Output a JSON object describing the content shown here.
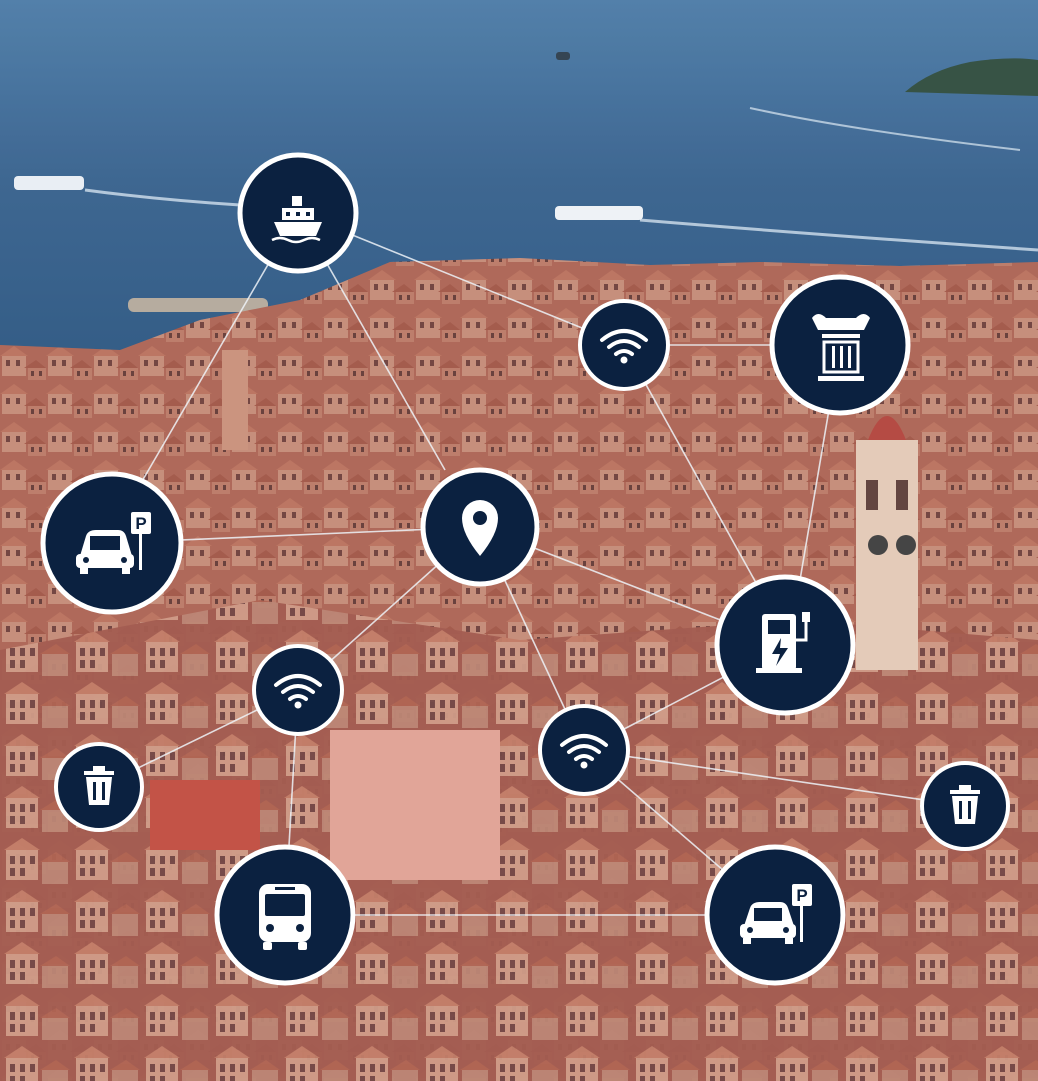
{
  "scene": {
    "description_colors": {
      "sea": "#3f6f9c",
      "sea_dark": "#2c5b88",
      "roof": "#c4694f",
      "wall": "#d9a08a",
      "icon_fill": "#0b2140",
      "icon_ring": "#ffffff",
      "link_line": "#e9eef5"
    }
  },
  "hubs": [
    {
      "name": "ferry-icon",
      "icon": "ship"
    },
    {
      "name": "wifi-icon",
      "icon": "wifi"
    },
    {
      "name": "museum-icon",
      "icon": "column"
    },
    {
      "name": "car-parking-icon",
      "icon": "car-parking"
    },
    {
      "name": "location-pin-icon",
      "icon": "pin"
    },
    {
      "name": "ev-charger-icon",
      "icon": "ev-charger"
    },
    {
      "name": "wifi-icon",
      "icon": "wifi"
    },
    {
      "name": "wifi-icon",
      "icon": "wifi"
    },
    {
      "name": "trash-bin-icon",
      "icon": "trash"
    },
    {
      "name": "trash-bin-icon",
      "icon": "trash"
    },
    {
      "name": "bus-icon",
      "icon": "bus"
    },
    {
      "name": "car-parking-icon",
      "icon": "car-parking"
    }
  ]
}
